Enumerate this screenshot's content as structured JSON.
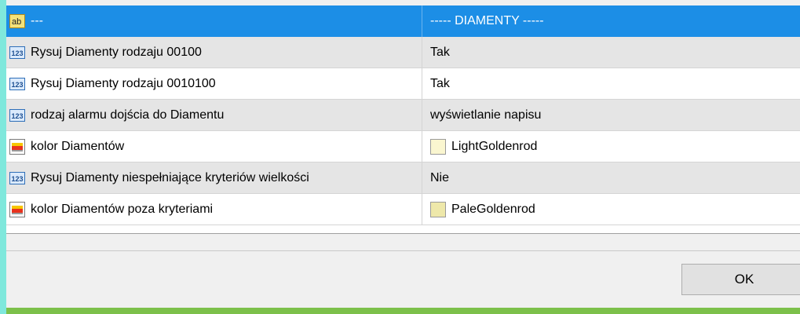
{
  "header": {
    "name": "---",
    "value": "----- DIAMENTY -----"
  },
  "rows": [
    {
      "icon": "number-123-icon",
      "label": "Rysuj Diamenty rodzaju 00100",
      "value": "Tak"
    },
    {
      "icon": "number-123-icon",
      "label": "Rysuj Diamenty rodzaju 0010100",
      "value": "Tak"
    },
    {
      "icon": "number-123-icon",
      "label": "rodzaj alarmu dojścia do Diamentu",
      "value": "wyświetlanie napisu"
    },
    {
      "icon": "color-palette-icon",
      "label": "kolor Diamentów",
      "value": "LightGoldenrod",
      "swatch": "#faf6d0"
    },
    {
      "icon": "number-123-icon",
      "label": "Rysuj Diamenty niespełniające kryteriów wielkości",
      "value": "Nie"
    },
    {
      "icon": "color-palette-icon",
      "label": "kolor Diamentów poza kryteriami",
      "value": "PaleGoldenrod",
      "swatch": "#eee8aa"
    }
  ],
  "buttons": {
    "ok_label": "OK"
  },
  "colors": {
    "selection": "#1c8ee6",
    "background": "#7fe8dc",
    "status_bar": "#7cc04a"
  }
}
